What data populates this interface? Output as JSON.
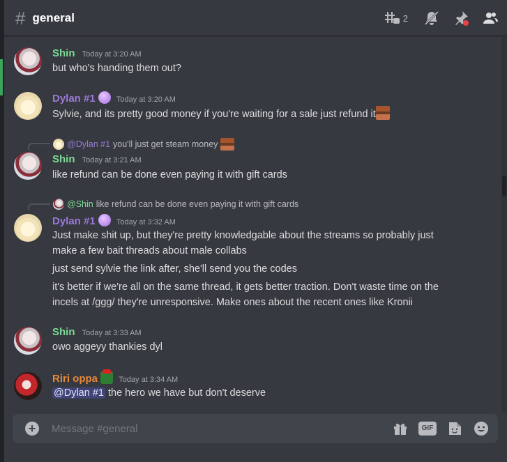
{
  "channel": {
    "name": "general",
    "thread_count": "2"
  },
  "messages": [
    {
      "author": "Shin",
      "time": "Today at 3:20 AM",
      "lines": [
        "but who's handing them out?"
      ]
    },
    {
      "author": "Dylan #1",
      "time": "Today at 3:20 AM",
      "lines": [
        "Sylvie, and its pretty good money if you're waiting for a sale just refund it"
      ]
    },
    {
      "reply": {
        "mention": "@Dylan #1",
        "text": "you'll just get steam money"
      },
      "author": "Shin",
      "time": "Today at 3:21 AM",
      "lines": [
        "like refund can be done even paying it with gift cards"
      ]
    },
    {
      "reply": {
        "mention": "@Shin",
        "text": "like refund can be done even paying it with gift cards"
      },
      "author": "Dylan #1",
      "time": "Today at 3:32 AM",
      "lines": [
        "Just make shit up, but they're pretty knowledgable about the streams so probably just",
        "make a few bait threads about male collabs",
        "just send sylvie the link after, she'll send you the codes",
        "it's better if we're all on the same thread, it gets better traction. Don't waste time on the",
        "incels at /ggg/ they're unresponsive. Make ones about the recent ones like Kronii"
      ]
    },
    {
      "author": "Shin",
      "time": "Today at 3:33 AM",
      "lines": [
        "owo aggeyy thankies dyl"
      ]
    },
    {
      "author": "Riri oppa",
      "time": "Today at 3:34 AM",
      "mention": "@Dylan #1",
      "lines": [
        " the hero we have but don't deserve"
      ]
    }
  ],
  "composer": {
    "placeholder": "Message #general"
  },
  "icons": [
    "threads-icon",
    "mute-bell-icon",
    "pin-icon",
    "members-icon",
    "plus-icon",
    "gift-icon",
    "gif-icon",
    "sticker-icon",
    "emoji-icon"
  ],
  "colors": {
    "background": "#36393f",
    "green_name": "#7ddc96",
    "purple_name": "#9a79d6",
    "orange_name": "#e5893a",
    "input_bg": "#40444b"
  }
}
